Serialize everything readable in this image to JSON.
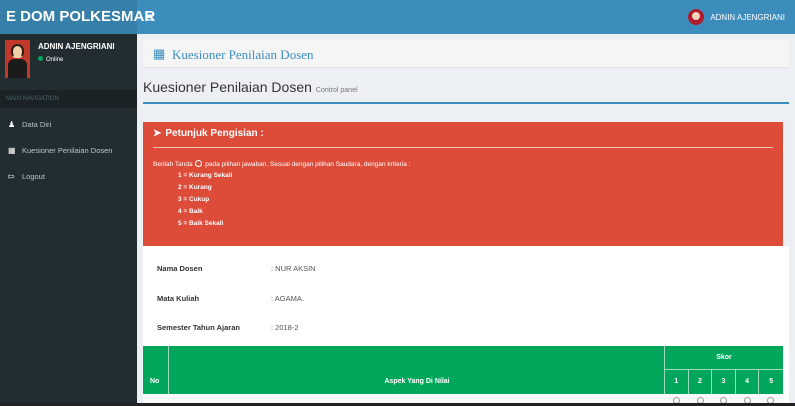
{
  "app": {
    "title": "E DOM POLKESMAR",
    "menu_icon": "hamburger-icon"
  },
  "topbar": {
    "user_name": "ADNIN AJENGRIANI"
  },
  "sidebar": {
    "user_name": "ADNIN AJENGRIANI",
    "status": "Online",
    "status_color": "#00a65a",
    "nav_header": "MAIN NAVIGATION",
    "items": [
      {
        "label": "Data Diri",
        "icon": "user-icon"
      },
      {
        "label": "Kuesioner Penilaian Dosen",
        "icon": "grid-icon"
      },
      {
        "label": "Logout",
        "icon": "logout-icon"
      }
    ]
  },
  "module": {
    "title": "Kuesioner Penilaian Dosen",
    "icon": "grid-icon"
  },
  "page": {
    "title": "Kuesioner Penilaian Dosen",
    "subtitle": "Control panel"
  },
  "alert": {
    "heading": "Petunjuk Pengisian :",
    "instruction_before": "Berilah Tanda",
    "instruction_after": "pada pilihan jawaban. Sesuai dengan pilihan Saudara, dengan kriteria :",
    "criteria": [
      "1 = Kurang Sekali",
      "2 = Kurang",
      "3 = Cukup",
      "4 = Baik",
      "5 = Baik Sekali"
    ],
    "color": "#dd4b39"
  },
  "info": [
    {
      "label": "Nama Dosen",
      "value": ": NUR AKSIN"
    },
    {
      "label": "Mata Kuliah",
      "value": ": AGAMA."
    },
    {
      "label": "Semester Tahun Ajaran",
      "value": ": 2018-2"
    }
  ],
  "table": {
    "header_no": "No",
    "header_aspek": "Aspek Yang Di Nilai",
    "header_skor": "Skor",
    "score_headers": [
      "1",
      "2",
      "3",
      "4",
      "5"
    ],
    "header_color": "#00a65a"
  }
}
